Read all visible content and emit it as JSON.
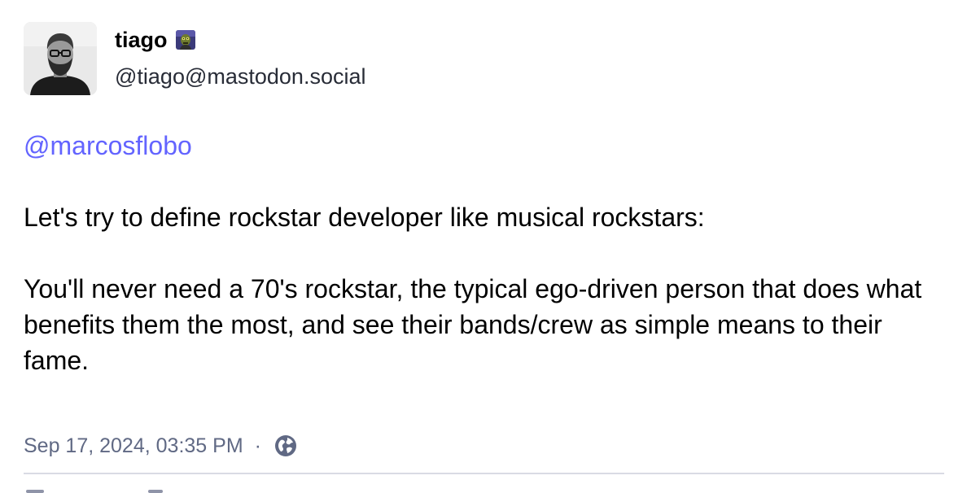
{
  "post": {
    "author": {
      "display_name": "tiago",
      "handle": "@tiago@mastodon.social",
      "avatar_icon": "user-avatar-photo",
      "emoji_icon": "custom-emoji-zombie"
    },
    "content": {
      "mention": "@marcosflobo",
      "paragraphs": [
        "Let's try to define rockstar developer like musical rockstars:",
        "You'll never need a 70's rockstar, the typical ego-driven person that does what benefits them the most, and see their bands/crew as simple means to their fame."
      ]
    },
    "meta": {
      "timestamp": "Sep 17, 2024, 03:35 PM",
      "separator": "·",
      "visibility_icon": "globe-icon"
    }
  },
  "colors": {
    "mention": "#6364ff",
    "meta_text": "#606984",
    "divider": "#d9dbe4"
  }
}
